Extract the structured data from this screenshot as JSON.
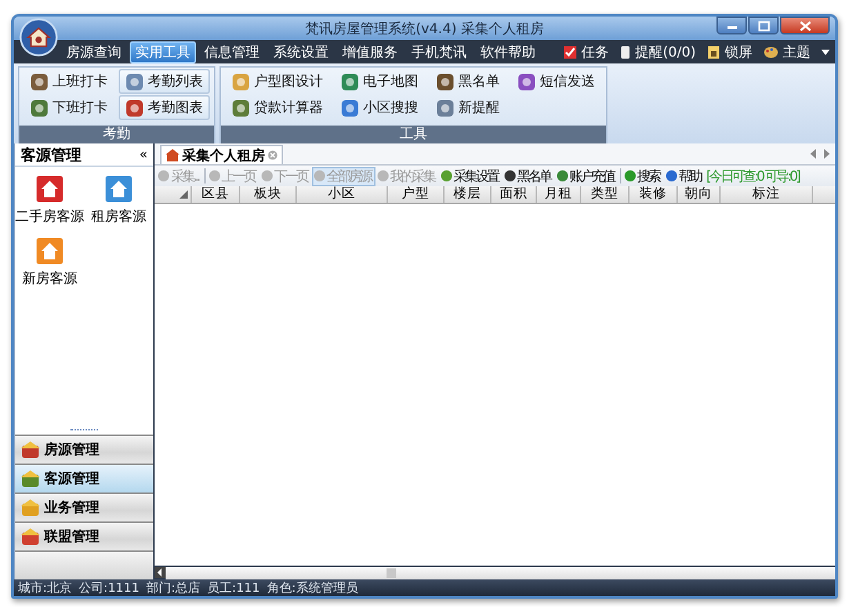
{
  "window": {
    "title": "梵讯房屋管理系统(v4.4) 采集个人租房"
  },
  "menu": [
    {
      "label": "房源查询",
      "selected": false
    },
    {
      "label": "实用工具",
      "selected": true
    },
    {
      "label": "信息管理",
      "selected": false
    },
    {
      "label": "系统设置",
      "selected": false
    },
    {
      "label": "增值服务",
      "selected": false
    },
    {
      "label": "手机梵讯",
      "selected": false
    },
    {
      "label": "软件帮助",
      "selected": false
    }
  ],
  "menu_right": [
    "任务",
    "提醒(0/0)",
    "锁屏",
    "主题"
  ],
  "ribbon": [
    {
      "label": "考勤",
      "items": [
        {
          "label": "上班打卡",
          "highlighted": false
        },
        {
          "label": "考勤列表",
          "highlighted": true
        },
        {
          "label": "下班打卡",
          "highlighted": false
        },
        {
          "label": "考勤图表",
          "highlighted": true
        }
      ]
    },
    {
      "label": "工具",
      "items": [
        {
          "label": "户型图设计",
          "highlighted": false
        },
        {
          "label": "电子地图",
          "highlighted": false
        },
        {
          "label": "黑名单",
          "highlighted": false
        },
        {
          "label": "短信发送",
          "highlighted": false
        },
        {
          "label": "贷款计算器",
          "highlighted": false
        },
        {
          "label": "小区搜搜",
          "highlighted": false
        },
        {
          "label": "新提醒",
          "highlighted": false
        }
      ]
    }
  ],
  "sidebar": {
    "title": "客源管理",
    "collapse": "«",
    "shortcuts": [
      "二手房客源",
      "租房客源",
      "新房客源"
    ],
    "nav": [
      {
        "label": "房源管理",
        "selected": false
      },
      {
        "label": "客源管理",
        "selected": true
      },
      {
        "label": "业务管理",
        "selected": false
      },
      {
        "label": "联盟管理",
        "selected": false
      }
    ]
  },
  "tab": {
    "label": "采集个人租房"
  },
  "toolbar": {
    "groups": [
      [
        {
          "label": "采集...",
          "disabled": true,
          "selected": false
        }
      ],
      [
        {
          "label": "上一页",
          "disabled": true,
          "selected": false
        },
        {
          "label": "下一页",
          "disabled": true,
          "selected": false
        },
        {
          "label": "全部房源",
          "disabled": true,
          "selected": true
        },
        {
          "label": "我的采集",
          "disabled": true,
          "selected": false
        },
        {
          "label": "采集设置",
          "disabled": false,
          "selected": false
        },
        {
          "label": "黑名单",
          "disabled": false,
          "selected": false
        },
        {
          "label": "账户充值",
          "disabled": false,
          "selected": false
        }
      ],
      [
        {
          "label": "搜索",
          "disabled": false,
          "selected": false
        },
        {
          "label": "帮助",
          "disabled": false,
          "selected": false
        }
      ]
    ],
    "quota": "[今日可查:0 可导:0]"
  },
  "table": {
    "columns": [
      "区县",
      "板块",
      "小区",
      "户型",
      "楼层",
      "面积",
      "月租",
      "类型",
      "装修",
      "朝向",
      "标注"
    ]
  },
  "status_bar": [
    "城市:北京",
    "公司:1111",
    "部门:总店",
    "员工:111",
    "角色:系统管理员"
  ]
}
